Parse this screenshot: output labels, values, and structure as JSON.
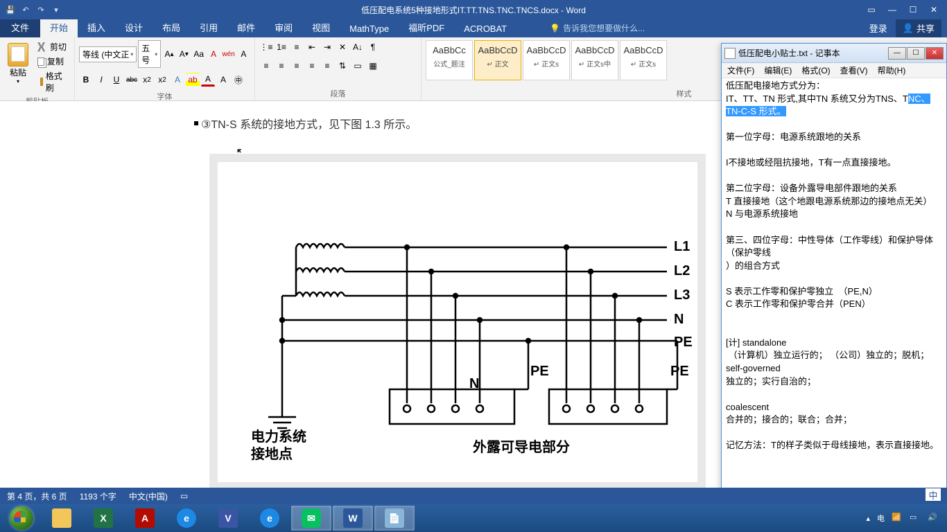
{
  "word": {
    "title": "低压配电系统5种接地形式IT.TT.TNS.TNC.TNCS.docx - Word",
    "login": "登录",
    "share": "共享",
    "tabs": {
      "file": "文件",
      "home": "开始",
      "insert": "插入",
      "design": "设计",
      "layout": "布局",
      "references": "引用",
      "mailings": "邮件",
      "review": "审阅",
      "view": "视图",
      "mathtype": "MathType",
      "foxit": "福昕PDF",
      "acrobat": "ACROBAT"
    },
    "tell_me": "告诉我您想要做什么...",
    "groups": {
      "clipboard": "剪贴板",
      "font": "字体",
      "paragraph": "段落",
      "styles": "样式"
    },
    "clipboard": {
      "paste": "粘贴",
      "cut": "剪切",
      "copy": "复制",
      "format_painter": "格式刷"
    },
    "font": {
      "name": "等线 (中文正",
      "size": "五号",
      "bold": "B",
      "italic": "I",
      "underline": "U",
      "strike": "abc"
    },
    "styles": [
      {
        "preview": "AaBbCc",
        "name": "公式_题注"
      },
      {
        "preview": "AaBbCcD",
        "name": "↵ 正文"
      },
      {
        "preview": "AaBbCcD",
        "name": "↵ 正文s"
      },
      {
        "preview": "AaBbCcD",
        "name": "↵ 正文s中"
      },
      {
        "preview": "AaBbCcD",
        "name": "↵ 正文s"
      }
    ],
    "doc": {
      "line": "③TN-S 系统的接地方式，见下图 1.3 所示。",
      "diagram": {
        "labels": {
          "L1": "L1",
          "L2": "L2",
          "L3": "L3",
          "N": "N",
          "PE": "PE",
          "N2": "N",
          "PE2": "PE",
          "PE3": "PE"
        },
        "text1": "电力系统",
        "text2": "接地点",
        "text3": "外露可导电部分"
      }
    },
    "status": {
      "page": "第 4 页，共 6 页",
      "words": "1193 个字",
      "lang": "中文(中国)"
    },
    "ime": "中"
  },
  "notepad": {
    "title": "低压配电小贴士.txt - 记事本",
    "menu": {
      "file": "文件(F)",
      "edit": "编辑(E)",
      "format": "格式(O)",
      "view": "查看(V)",
      "help": "帮助(H)"
    },
    "body_pre": "低压配电接地方式分为：\nIT、TT、TN 形式,其中TN 系统又分为TNS、T",
    "body_sel": "NC、TN-C-S 形式。",
    "body_post": "\n\n第一位字母：电源系统跟地的关系\n\nI不接地或经阻抗接地，T有一点直接接地。\n\n第二位字母：设备外露导电部件跟地的关系\nT 直接接地（这个地跟电源系统那边的接地点无关）\nN 与电源系统接地\n\n第三、四位字母：中性导体（工作零线）和保护导体（保护零线\n）的组合方式\n\nS 表示工作零和保护零独立  （PE,N）\nC 表示工作零和保护零合并（PEN）\n\n\n[计] standalone\n （计算机）独立运行的； （公司）独立的；脱机；\nself-governed\n独立的；实行自治的；\n\ncoalescent\n合并的；接合的；联合；合并；\n\n记忆方法：T的样子类似于母线接地，表示直接接地。"
  },
  "taskbar": {
    "tray_text": "电"
  }
}
